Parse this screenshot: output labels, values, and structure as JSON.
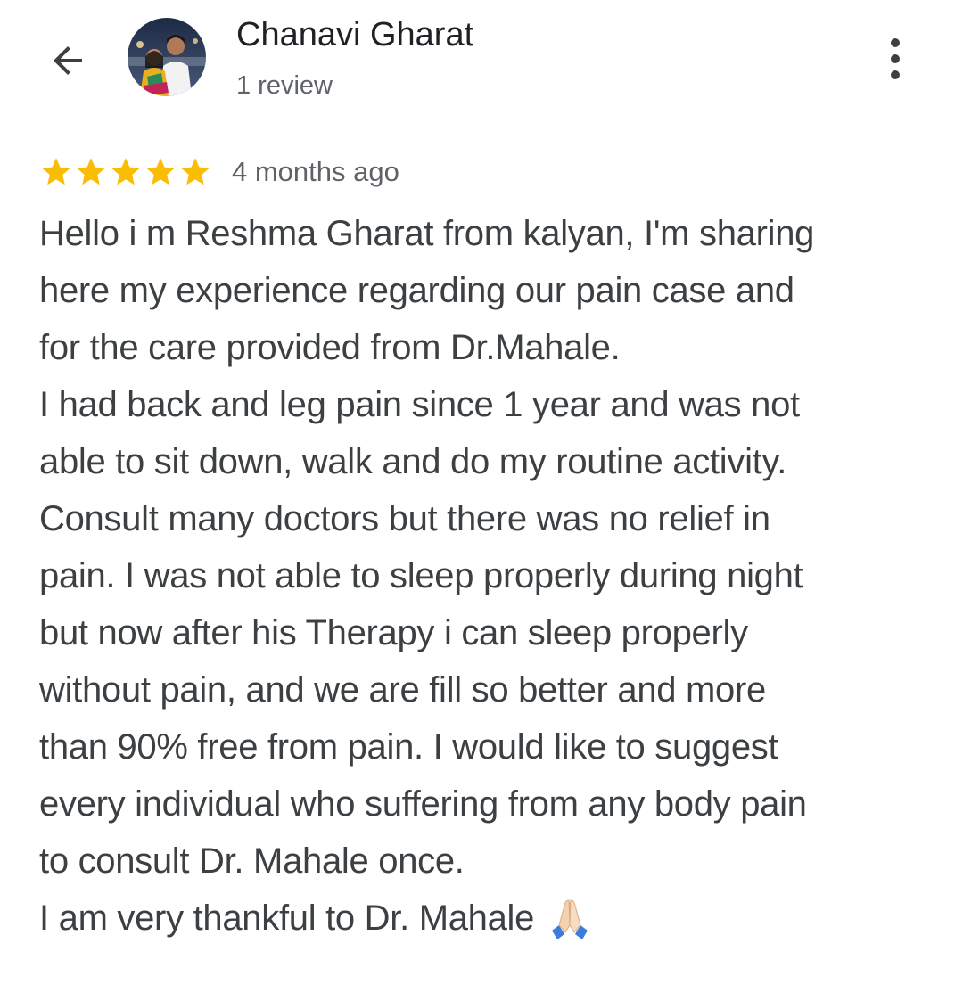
{
  "reviewer": {
    "name": "Chanavi Gharat",
    "review_count": "1 review"
  },
  "review": {
    "rating": 5,
    "max_rating": 5,
    "time": "4 months ago",
    "lines": [
      "Hello i m Reshma Gharat from kalyan, I'm sharing",
      "here my experience regarding our pain case and",
      "for the care provided from Dr.Mahale.",
      "I had back and leg pain since 1 year and was not",
      "able to sit down, walk and do my routine activity.",
      "Consult many doctors but there was no relief in",
      "pain. I was not able to sleep properly during night",
      "but now after his Therapy i can sleep properly",
      "without pain, and we are fill so better and more",
      "than 90% free from pain. I would like to suggest",
      "every individual who suffering from any body pain",
      "to consult Dr. Mahale once."
    ],
    "last_line": "I am very thankful to Dr. Mahale",
    "last_emoji": "folded-hands-emoji"
  },
  "icons": {
    "back": "arrow-back-icon",
    "more": "more-vert-icon",
    "star": "star-icon"
  },
  "colors": {
    "star": "#fbbc04",
    "text": "#3c4043",
    "secondary_text": "#5f6368",
    "name": "#202124",
    "background": "#ffffff"
  }
}
